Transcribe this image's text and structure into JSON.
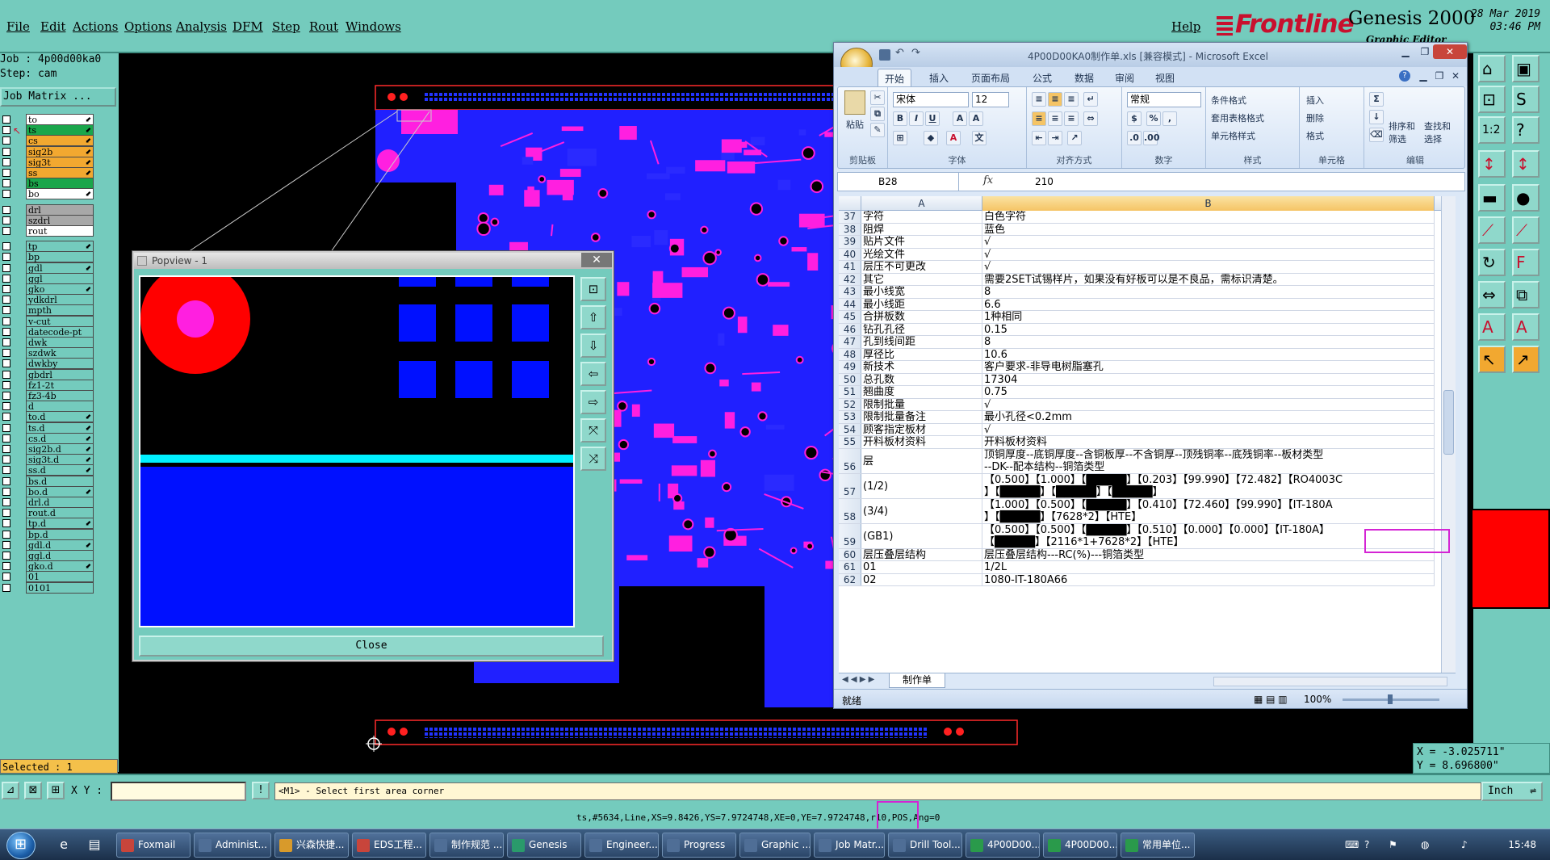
{
  "menu": {
    "items": [
      "File",
      "Edit",
      "Actions",
      "Options",
      "Analysis",
      "DFM",
      "Step",
      "Rout",
      "Windows"
    ],
    "help": "Help"
  },
  "brand": {
    "logo": "Frontline",
    "product": "Genesis 2000",
    "subtitle": "Graphic Editor",
    "date": "28 Mar 2019",
    "time": "03:46 PM"
  },
  "job": {
    "job_line": "Job : 4p00d00ka0",
    "step_line": "Step: cam",
    "matrix_button": "Job Matrix ..."
  },
  "layers": [
    {
      "name": "to",
      "color": "#ffffff",
      "arrow": true
    },
    {
      "name": "ts",
      "color": "#1aa64b",
      "arrow": true,
      "work": true
    },
    {
      "name": "cs",
      "color": "#f2a830",
      "arrow": true
    },
    {
      "name": "sig2b",
      "color": "#f2a830",
      "arrow": true
    },
    {
      "name": "sig3t",
      "color": "#f2a830",
      "arrow": true
    },
    {
      "name": "ss",
      "color": "#f2a830",
      "arrow": true
    },
    {
      "name": "bs",
      "color": "#1aa64b",
      "arrow": false
    },
    {
      "name": "bo",
      "color": "#ffffff",
      "arrow": true
    },
    {
      "name": "drl",
      "color": "#a8a8a8",
      "arrow": false
    },
    {
      "name": "szdrl",
      "color": "#a8a8a8",
      "arrow": false
    },
    {
      "name": "rout",
      "color": "#ffffff",
      "arrow": false
    },
    {
      "name": "tp",
      "color": "#74cbbd",
      "arrow": true
    },
    {
      "name": "bp",
      "color": "#74cbbd",
      "arrow": false
    },
    {
      "name": "gdl",
      "color": "#74cbbd",
      "arrow": true
    },
    {
      "name": "ggl",
      "color": "#74cbbd",
      "arrow": false
    },
    {
      "name": "gko",
      "color": "#74cbbd",
      "arrow": true
    },
    {
      "name": "ydkdrl",
      "color": "#74cbbd",
      "arrow": false
    },
    {
      "name": "mpth",
      "color": "#74cbbd",
      "arrow": false
    },
    {
      "name": "v-cut",
      "color": "#74cbbd",
      "arrow": false
    },
    {
      "name": "datecode-pt",
      "color": "#74cbbd",
      "arrow": false
    },
    {
      "name": "dwk",
      "color": "#74cbbd",
      "arrow": false
    },
    {
      "name": "szdwk",
      "color": "#74cbbd",
      "arrow": false
    },
    {
      "name": "dwkby",
      "color": "#74cbbd",
      "arrow": false
    },
    {
      "name": "gbdrl",
      "color": "#74cbbd",
      "arrow": false
    },
    {
      "name": "fz1-2t",
      "color": "#74cbbd",
      "arrow": false
    },
    {
      "name": "fz3-4b",
      "color": "#74cbbd",
      "arrow": false
    },
    {
      "name": "d",
      "color": "#74cbbd",
      "arrow": false
    },
    {
      "name": "to.d",
      "color": "#74cbbd",
      "arrow": true
    },
    {
      "name": "ts.d",
      "color": "#74cbbd",
      "arrow": true
    },
    {
      "name": "cs.d",
      "color": "#74cbbd",
      "arrow": true
    },
    {
      "name": "sig2b.d",
      "color": "#74cbbd",
      "arrow": true
    },
    {
      "name": "sig3t.d",
      "color": "#74cbbd",
      "arrow": true
    },
    {
      "name": "ss.d",
      "color": "#74cbbd",
      "arrow": true
    },
    {
      "name": "bs.d",
      "color": "#74cbbd",
      "arrow": false
    },
    {
      "name": "bo.d",
      "color": "#74cbbd",
      "arrow": true
    },
    {
      "name": "drl.d",
      "color": "#74cbbd",
      "arrow": false
    },
    {
      "name": "rout.d",
      "color": "#74cbbd",
      "arrow": false
    },
    {
      "name": "tp.d",
      "color": "#74cbbd",
      "arrow": true
    },
    {
      "name": "bp.d",
      "color": "#74cbbd",
      "arrow": false
    },
    {
      "name": "gdl.d",
      "color": "#74cbbd",
      "arrow": true
    },
    {
      "name": "ggl.d",
      "color": "#74cbbd",
      "arrow": false
    },
    {
      "name": "gko.d",
      "color": "#74cbbd",
      "arrow": true
    },
    {
      "name": "01",
      "color": "#74cbbd",
      "arrow": false
    },
    {
      "name": "0101",
      "color": "#74cbbd",
      "arrow": false
    }
  ],
  "selected_label": "Selected : 1",
  "coords": {
    "x": "X = -3.025711\"",
    "y": "Y =  8.696800\""
  },
  "cmdbar": {
    "xy_label": "X Y :",
    "xy_value": "",
    "prompt": "<M1> - Select first area corner",
    "unit": "Inch"
  },
  "status_line": "ts,#5634,Line,XS=9.8426,YS=7.9724748,XE=0,YE=7.9724748,r10,POS,Ang=0",
  "popview": {
    "title": "Popview - 1",
    "close_label": "Close"
  },
  "excel": {
    "title": "4P00D00KA0制作单.xls [兼容模式] - Microsoft Excel",
    "tabs": [
      "开始",
      "插入",
      "页面布局",
      "公式",
      "数据",
      "审阅",
      "视图"
    ],
    "active_tab": "开始",
    "ribbon": {
      "paste": "粘贴",
      "font_name": "宋体",
      "font_size": "12",
      "number_format": "常规",
      "cond_format": "条件格式",
      "table_format": "套用表格格式",
      "cell_style": "单元格样式",
      "insert": "插入",
      "delete": "删除",
      "format": "格式",
      "sort_filter": "排序和\n筛选",
      "find_select": "查找和\n选择",
      "groups": [
        "剪贴板",
        "字体",
        "对齐方式",
        "数字",
        "样式",
        "单元格",
        "编辑"
      ]
    },
    "name_box": "B28",
    "formula_value": "210",
    "columns": [
      "A",
      "B"
    ],
    "rows": [
      {
        "n": "37",
        "a": "字符",
        "b": [
          "白色字符"
        ]
      },
      {
        "n": "38",
        "a": "阻焊",
        "b": [
          "蓝色"
        ]
      },
      {
        "n": "39",
        "a": "贴片文件",
        "b": [
          "√"
        ]
      },
      {
        "n": "40",
        "a": "光绘文件",
        "b": [
          "√"
        ]
      },
      {
        "n": "41",
        "a": "层压不可更改",
        "b": [
          "√"
        ]
      },
      {
        "n": "42",
        "a": "其它",
        "b": [
          "需要2SET试锡样片，如果没有好板可以是不良品，需标识清楚。"
        ]
      },
      {
        "n": "43",
        "a": "最小线宽",
        "b": [
          "8"
        ]
      },
      {
        "n": "44",
        "a": "最小线距",
        "b": [
          "6.6"
        ]
      },
      {
        "n": "45",
        "a": "合拼板数",
        "b": [
          "1种相同"
        ]
      },
      {
        "n": "46",
        "a": "钻孔孔径",
        "b": [
          "0.15"
        ]
      },
      {
        "n": "47",
        "a": "孔到线间距",
        "b": [
          "8"
        ]
      },
      {
        "n": "48",
        "a": "厚径比",
        "b": [
          "10.6"
        ]
      },
      {
        "n": "49",
        "a": "新技术",
        "b": [
          "客户要求-非导电树脂塞孔"
        ]
      },
      {
        "n": "50",
        "a": "总孔数",
        "b": [
          "17304"
        ]
      },
      {
        "n": "51",
        "a": "翘曲度",
        "b": [
          "0.75"
        ]
      },
      {
        "n": "52",
        "a": "限制批量",
        "b": [
          "√"
        ]
      },
      {
        "n": "53",
        "a": "限制批量备注",
        "b": [
          "最小孔径<0.2mm"
        ]
      },
      {
        "n": "54",
        "a": "顾客指定板材",
        "b": [
          "√"
        ]
      },
      {
        "n": "55",
        "a": "开料板材资料",
        "b": [
          "开料板材资料"
        ]
      },
      {
        "n": "56",
        "a": "层",
        "b": [
          "顶铜厚度--底铜厚度--含铜板厚--不含铜厚--顶残铜率--底残铜率--板材类型",
          "--DK--配本结构--铜箔类型"
        ],
        "tall": true
      },
      {
        "n": "57",
        "a": "(1/2)",
        "b": [
          "【0.500】【1.000】【█████】【0.203】【99.990】【72.482】【RO4003C",
          "】【█████】【█████】【█████】"
        ],
        "tall": true
      },
      {
        "n": "58",
        "a": "(3/4)",
        "b": [
          "【1.000】【0.500】【█████】【0.410】【72.460】【99.990】【IT-180A",
          "】【█████】【7628*2】【HTE】"
        ],
        "tall": true
      },
      {
        "n": "59",
        "a": "(GB1)",
        "b": [
          "【0.500】【0.500】【█████】【0.510】【0.000】【0.000】【IT-180A】",
          "【█████】【2116*1+7628*2】【HTE】"
        ],
        "tall": true
      },
      {
        "n": "60",
        "a": "层压叠层结构",
        "b": [
          "层压叠层结构---RC(%)---铜箔类型"
        ]
      },
      {
        "n": "61",
        "a": "01",
        "b": [
          "1/2L"
        ]
      },
      {
        "n": "62",
        "a": "02",
        "b": [
          "1080-IT-180A66"
        ]
      }
    ],
    "sheet_tab": "制作单",
    "status_ready": "就绪",
    "zoom": "100%"
  },
  "taskbar": {
    "tasks": [
      {
        "label": "Foxmail",
        "color": "#c8453b"
      },
      {
        "label": "Administ...",
        "color": "#4f6e96"
      },
      {
        "label": "兴森快捷...",
        "color": "#d89a2b"
      },
      {
        "label": "EDS工程...",
        "color": "#c8453b"
      },
      {
        "label": "制作规范 ...",
        "color": "#4f6e96"
      },
      {
        "label": "Genesis",
        "color": "#2a9a6b"
      },
      {
        "label": "Engineer...",
        "color": "#4f6e96"
      },
      {
        "label": "Progress",
        "color": "#4f6e96"
      },
      {
        "label": "Graphic ...",
        "color": "#4f6e96"
      },
      {
        "label": "Job Matr...",
        "color": "#4f6e96"
      },
      {
        "label": "Drill Tool...",
        "color": "#4f6e96"
      },
      {
        "label": "4P00D00...",
        "color": "#2a9a4b"
      },
      {
        "label": "4P00D00...",
        "color": "#2a9a4b"
      },
      {
        "label": "常用单位...",
        "color": "#2a9a4b"
      }
    ],
    "clock": "15:48"
  }
}
